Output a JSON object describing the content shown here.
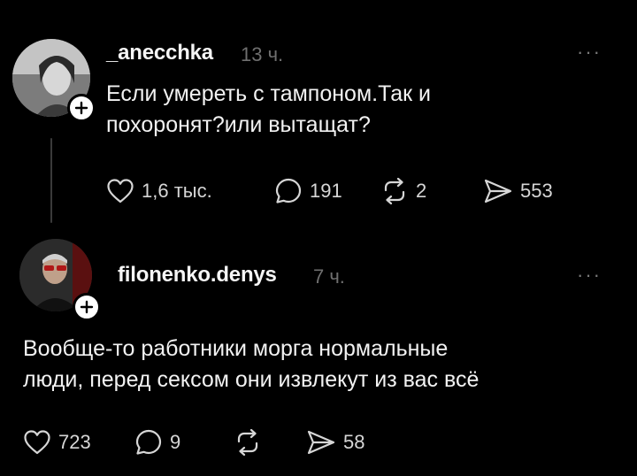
{
  "posts": [
    {
      "username": "_anecchka",
      "time": "13 ч.",
      "text": "Если умереть с тампоном.Так и\nпохоронят?или вытащат?",
      "likes": "1,6 тыс.",
      "comments": "191",
      "reposts": "2",
      "shares": "553",
      "more": "···"
    },
    {
      "username": "filonenko.denys",
      "time": "7 ч.",
      "text": "Вообще-то работники морга нормальные\nлюди, перед сексом они извлекут из вас всё",
      "likes": "723",
      "comments": "9",
      "reposts": "",
      "shares": "58",
      "more": "···"
    }
  ],
  "icons": {
    "like": "heart-icon",
    "comment": "comment-icon",
    "repost": "repost-icon",
    "share": "send-icon",
    "follow": "plus-icon"
  },
  "colors": {
    "background": "#000000",
    "text": "#f2f2f2",
    "muted": "#6f6f6f"
  }
}
